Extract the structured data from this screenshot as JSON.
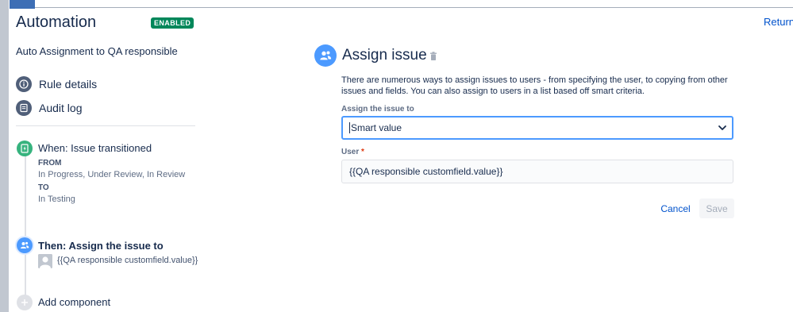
{
  "header": {
    "title": "Automation",
    "status_badge": "ENABLED",
    "return_label": "Return"
  },
  "sidebar": {
    "rule_name": "Auto Assignment to QA responsible",
    "items": [
      {
        "label": "Rule details",
        "icon": "info-icon"
      },
      {
        "label": "Audit log",
        "icon": "list-icon"
      }
    ],
    "trigger": {
      "title": "When: Issue transitioned",
      "from_label": "FROM",
      "from_value": "In Progress, Under Review, In Review",
      "to_label": "TO",
      "to_value": "In Testing",
      "icon": "trigger-icon"
    },
    "action": {
      "title": "Then: Assign the issue to",
      "value": "{{QA responsible customfield.value}}",
      "icon": "assign-user-icon"
    },
    "add_component_label": "Add component"
  },
  "panel": {
    "title": "Assign issue",
    "description": "There are numerous ways to assign issues to users - from specifying the user, to copying from other issues and fields. You can also assign to users in a list based off smart criteria.",
    "assign_label": "Assign the issue to",
    "assign_value": "Smart value",
    "user_label": "User",
    "required_mark": "*",
    "user_value": "{{QA responsible customfield.value}}",
    "cancel_label": "Cancel",
    "save_label": "Save"
  },
  "colors": {
    "accent": "#0052cc",
    "badge_green": "#00875a",
    "trigger_green": "#36b37e",
    "action_blue": "#4c9aff",
    "focus_border": "#4c9aff"
  }
}
